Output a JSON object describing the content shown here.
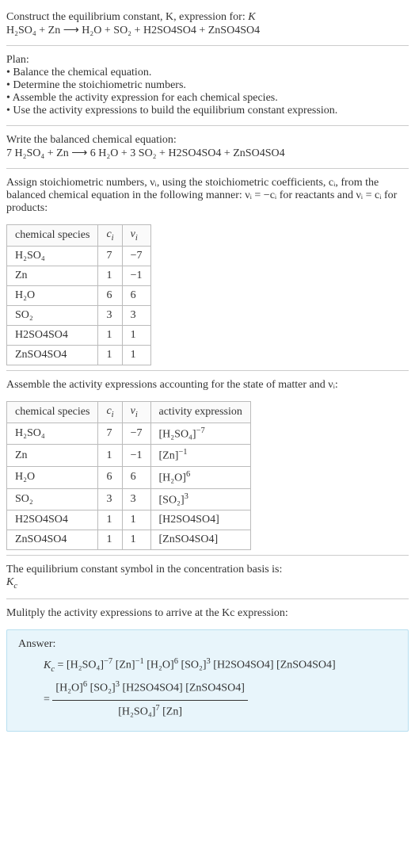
{
  "intro": {
    "line1": "Construct the equilibrium constant, K, expression for:",
    "equation": "H₂SO₄ + Zn ⟶ H₂O + SO₂ + H2SO4SO4 + ZnSO4SO4"
  },
  "plan": {
    "heading": "Plan:",
    "items": [
      "• Balance the chemical equation.",
      "• Determine the stoichiometric numbers.",
      "• Assemble the activity expression for each chemical species.",
      "• Use the activity expressions to build the equilibrium constant expression."
    ]
  },
  "balanced": {
    "heading": "Write the balanced chemical equation:",
    "equation": "7 H₂SO₄ + Zn ⟶ 6 H₂O + 3 SO₂ + H2SO4SO4 + ZnSO4SO4"
  },
  "assign": {
    "text1": "Assign stoichiometric numbers, νᵢ, using the stoichiometric coefficients, cᵢ, from the balanced chemical equation in the following manner: νᵢ = −cᵢ for reactants and νᵢ = cᵢ for products:"
  },
  "table1": {
    "headers": [
      "chemical species",
      "cᵢ",
      "νᵢ"
    ],
    "rows": [
      [
        "H₂SO₄",
        "7",
        "−7"
      ],
      [
        "Zn",
        "1",
        "−1"
      ],
      [
        "H₂O",
        "6",
        "6"
      ],
      [
        "SO₂",
        "3",
        "3"
      ],
      [
        "H2SO4SO4",
        "1",
        "1"
      ],
      [
        "ZnSO4SO4",
        "1",
        "1"
      ]
    ]
  },
  "assemble": {
    "text": "Assemble the activity expressions accounting for the state of matter and νᵢ:"
  },
  "table2": {
    "headers": [
      "chemical species",
      "cᵢ",
      "νᵢ",
      "activity expression"
    ],
    "rows": [
      {
        "sp": "H₂SO₄",
        "c": "7",
        "v": "−7",
        "act_base": "[H₂SO₄]",
        "act_exp": "−7"
      },
      {
        "sp": "Zn",
        "c": "1",
        "v": "−1",
        "act_base": "[Zn]",
        "act_exp": "−1"
      },
      {
        "sp": "H₂O",
        "c": "6",
        "v": "6",
        "act_base": "[H₂O]",
        "act_exp": "6"
      },
      {
        "sp": "SO₂",
        "c": "3",
        "v": "3",
        "act_base": "[SO₂]",
        "act_exp": "3"
      },
      {
        "sp": "H2SO4SO4",
        "c": "1",
        "v": "1",
        "act_base": "[H2SO4SO4]",
        "act_exp": ""
      },
      {
        "sp": "ZnSO4SO4",
        "c": "1",
        "v": "1",
        "act_base": "[ZnSO4SO4]",
        "act_exp": ""
      }
    ]
  },
  "symbol": {
    "text": "The equilibrium constant symbol in the concentration basis is:",
    "sym": "K",
    "sub": "c"
  },
  "multiply": {
    "text": "Mulitply the activity expressions to arrive at the Kc expression:"
  },
  "answer": {
    "label": "Answer:",
    "lhs": "Kc =",
    "line1_terms": [
      {
        "b": "[H₂SO₄]",
        "e": "−7"
      },
      {
        "b": "[Zn]",
        "e": "−1"
      },
      {
        "b": "[H₂O]",
        "e": "6"
      },
      {
        "b": "[SO₂]",
        "e": "3"
      },
      {
        "b": "[H2SO4SO4]",
        "e": ""
      },
      {
        "b": "[ZnSO4SO4]",
        "e": ""
      }
    ],
    "eq_sign": "=",
    "numerator": [
      {
        "b": "[H₂O]",
        "e": "6"
      },
      {
        "b": "[SO₂]",
        "e": "3"
      },
      {
        "b": "[H2SO4SO4]",
        "e": ""
      },
      {
        "b": "[ZnSO4SO4]",
        "e": ""
      }
    ],
    "denominator": [
      {
        "b": "[H₂SO₄]",
        "e": "7"
      },
      {
        "b": "[Zn]",
        "e": ""
      }
    ]
  }
}
